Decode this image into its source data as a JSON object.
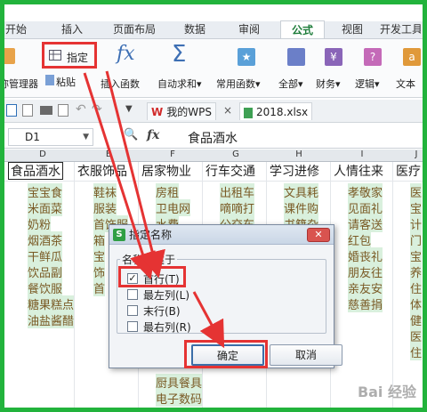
{
  "ribbon_tabs": [
    "开始",
    "插入",
    "页面布局",
    "数据",
    "审阅",
    "公式",
    "视图",
    "开发工具"
  ],
  "ribbon": {
    "name_manager": "称管理器",
    "paste": "粘贴",
    "specify": "指定",
    "insert_function": "插入函数",
    "autosum": "自动求和",
    "common_functions": "常用函数",
    "all": "全部",
    "financial": "财务",
    "logical": "逻辑",
    "text": "文本"
  },
  "quick_access": {
    "wps_tab": "我的WPS",
    "doc_tab": "2018.xlsx"
  },
  "formula_bar": {
    "name_box": "D1",
    "fx": "fx",
    "content": "食品酒水"
  },
  "columns": [
    "D",
    "E",
    "F",
    "G",
    "H",
    "I",
    "J"
  ],
  "table": {
    "headers": [
      "食品酒水",
      "衣服饰品",
      "居家物业",
      "行车交通",
      "学习进修",
      "人情往来",
      "医疗"
    ],
    "col_d": [
      "宝宝食",
      "米面菜",
      "奶粉",
      "烟酒茶",
      "干鲜瓜",
      "饮品副",
      "餐饮服",
      "糖果糕点",
      "油盐酱醋"
    ],
    "col_e": [
      "鞋袜",
      "服装",
      "首饰服",
      "箱",
      "宝",
      "饰",
      "首"
    ],
    "col_f": [
      "房租",
      "卫电网",
      "水费"
    ],
    "col_g": [
      "出租车",
      "嘀嘀打",
      "公交车"
    ],
    "col_h": [
      "文具耗",
      "课件购",
      "书籍杂"
    ],
    "col_i": [
      "孝敬家",
      "见面礼",
      "请客送",
      "红包",
      "婚丧礼",
      "朋友往",
      "亲友安",
      "慈善捐"
    ],
    "col_j": [
      "医",
      "宝",
      "计",
      "门",
      "宝",
      "养",
      "住",
      "体",
      "健",
      "医",
      "住"
    ],
    "bottom_f": [
      "厨具餐具",
      "电子数码"
    ]
  },
  "dialog": {
    "title": "指定名称",
    "close": "✕",
    "group_label": "名称创建于",
    "options": [
      {
        "label": "首行(T)",
        "checked": true
      },
      {
        "label": "最左列(L)",
        "checked": false
      },
      {
        "label": "末行(B)",
        "checked": false
      },
      {
        "label": "最右列(R)",
        "checked": false
      }
    ],
    "ok": "确定",
    "cancel": "取消"
  },
  "watermark": "Bai 经验",
  "colors": {
    "frame": "#22b33c",
    "highlight": "#e53333",
    "active_tab": "#1d7c3a"
  }
}
